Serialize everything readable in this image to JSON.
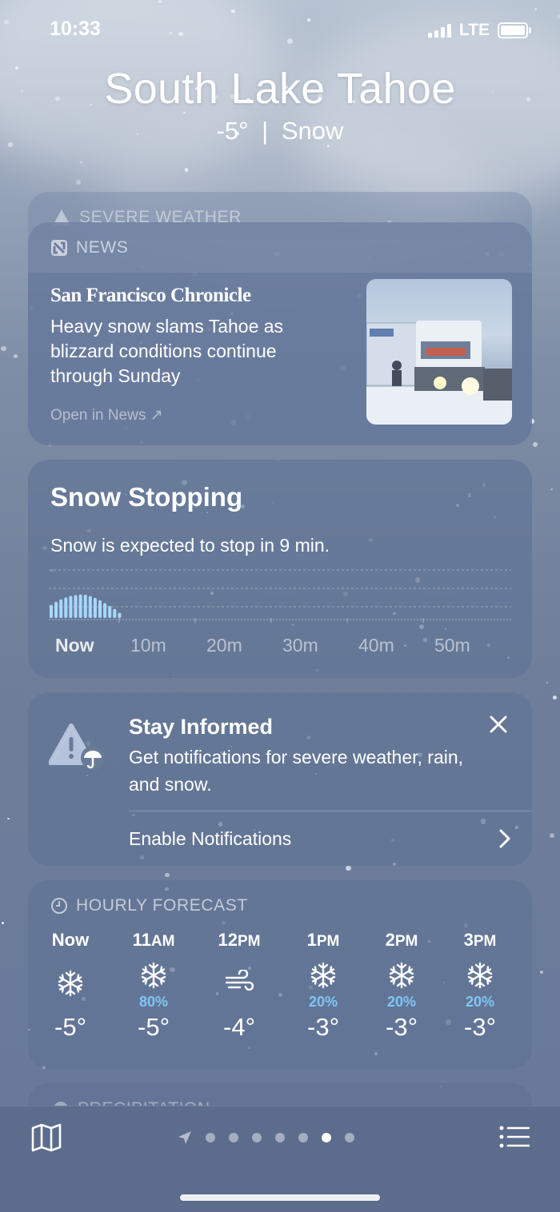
{
  "status_bar": {
    "time": "10:33",
    "network": "LTE"
  },
  "location": {
    "name": "South Lake Tahoe",
    "temp": "-5°",
    "separator": "|",
    "condition": "Snow"
  },
  "severe_peek": {
    "label": "SEVERE WEATHER"
  },
  "news": {
    "header": "NEWS",
    "source": "San Francisco Chronicle",
    "headline": "Heavy snow slams Tahoe as blizzard conditions continue through Sunday",
    "open_link": "Open in News ↗"
  },
  "minute_card": {
    "title": "Snow Stopping",
    "description": "Snow is expected to stop in 9 min.",
    "x_labels": [
      "Now",
      "10m",
      "20m",
      "30m",
      "40m",
      "50m"
    ],
    "chart_data": {
      "type": "bar",
      "x": [
        0,
        1,
        2,
        3,
        4,
        5,
        6,
        7,
        8,
        9,
        10,
        11,
        12,
        13,
        14,
        15,
        16,
        17,
        18,
        19,
        20,
        21,
        22,
        23,
        24,
        25,
        26,
        27,
        28,
        29,
        30,
        31,
        32,
        33,
        34,
        35,
        36,
        37,
        38,
        39,
        40,
        41,
        42,
        43,
        44,
        45,
        46,
        47,
        48,
        49,
        50,
        51,
        52,
        53,
        54,
        55,
        56,
        57,
        58,
        59
      ],
      "values": [
        0.55,
        0.68,
        0.78,
        0.86,
        0.92,
        0.96,
        0.98,
        0.97,
        0.92,
        0.84,
        0.74,
        0.62,
        0.5,
        0.38,
        0.22,
        0,
        0,
        0,
        0,
        0,
        0,
        0,
        0,
        0,
        0,
        0,
        0,
        0,
        0,
        0,
        0,
        0,
        0,
        0,
        0,
        0,
        0,
        0,
        0,
        0,
        0,
        0,
        0,
        0,
        0,
        0,
        0,
        0,
        0,
        0,
        0,
        0,
        0,
        0,
        0,
        0,
        0,
        0,
        0,
        0
      ],
      "tick_labels": [
        "Now",
        "10m",
        "20m",
        "30m",
        "40m",
        "50m"
      ],
      "xlabel": "",
      "ylabel": "",
      "grid": true
    }
  },
  "stay_informed": {
    "title": "Stay Informed",
    "description": "Get notifications for severe weather, rain, and snow.",
    "action": "Enable Notifications"
  },
  "hourly": {
    "header": "HOURLY FORECAST",
    "items": [
      {
        "time": "Now",
        "ampm": "",
        "icon": "snowflake-icon",
        "precip": "",
        "temp": "-5°"
      },
      {
        "time": "11",
        "ampm": "AM",
        "icon": "snowflake-icon",
        "precip": "80%",
        "temp": "-5°"
      },
      {
        "time": "12",
        "ampm": "PM",
        "icon": "wind-icon",
        "precip": "",
        "temp": "-4°"
      },
      {
        "time": "1",
        "ampm": "PM",
        "icon": "snowflake-icon",
        "precip": "20%",
        "temp": "-3°"
      },
      {
        "time": "2",
        "ampm": "PM",
        "icon": "snowflake-icon",
        "precip": "20%",
        "temp": "-3°"
      },
      {
        "time": "3",
        "ampm": "PM",
        "icon": "snowflake-icon",
        "precip": "20%",
        "temp": "-3°"
      }
    ]
  },
  "precip_peek": {
    "label": "PRECIPITATION"
  },
  "bottom_bar": {
    "page_count": 8,
    "active_page": 7
  },
  "colors": {
    "accent_precip": "#7fc6f4",
    "card_bg": "#607294"
  }
}
